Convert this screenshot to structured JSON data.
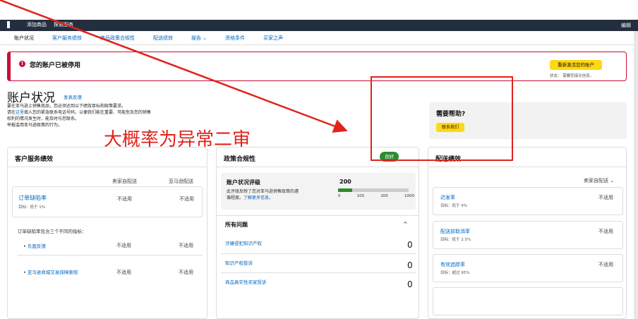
{
  "topbar": {
    "links": [
      "添加商品",
      "探索服务"
    ],
    "edit": "编辑"
  },
  "tabs": [
    "账户状况",
    "客户服务绩效",
    "商品政策合规性",
    "配送绩效",
    "报告 ⌄",
    "资格条件",
    "买家之声"
  ],
  "alert": {
    "title": "您的账户已被停用",
    "button": "重新激活您的账户",
    "status": "状态：  需要您接交信息。"
  },
  "page": {
    "title": "账户状况",
    "feedback": "发表反馈",
    "intro_line1": "要在亚马逊上销售商品，您必须达到以下绩效目标和政策要求。",
    "intro_line2_link": "这里",
    "intro_line2_pre": "请在",
    "intro_line2_post": "填入您的紧急联系电话号码，以便我们能在重要、可能危及您的销售",
    "intro_line3": "权利的情况发生时，能及时与您联系。",
    "intro_line4": "举报滥用亚马逊政策的行为。",
    "annotation": "大概率为异常二审"
  },
  "help": {
    "title": "需要帮助?",
    "button": "联系我们"
  },
  "customer_service": {
    "title": "客户服务绩效",
    "col1": "卖家自配送",
    "col2": "亚马逊配送",
    "metric_name": "订单缺陷率",
    "metric_target": "目标：低于 1%",
    "metric_v1": "不适用",
    "metric_v2": "不适用",
    "sub_caption": "订单缺陷率包含三个不同的指标：",
    "items": [
      {
        "label": "负面反馈",
        "v1": "不适用",
        "v2": "不适用"
      },
      {
        "label": "亚马逊商城交易保障索赔",
        "v1": "不适用",
        "v2": "不适用"
      }
    ]
  },
  "policy": {
    "title": "政策合规性",
    "badge": "良好",
    "rating_title": "账户状况评级",
    "rating_value": "200",
    "rating_desc1": "此评级反映了您对亚马逊销售政策的遵",
    "rating_desc2": "循程度。",
    "rating_link": "了解更多信息。",
    "scale": [
      "0",
      "100",
      "200",
      "1000"
    ],
    "rating_fraction": 0.2,
    "issues_title": "所有问题",
    "collapse": "^",
    "issues": [
      {
        "label": "涉嫌侵犯知识产权",
        "count": "0"
      },
      {
        "label": "知识产权投诉",
        "count": "0"
      },
      {
        "label": "商品真实性买家投诉",
        "count": "0"
      }
    ]
  },
  "shipping": {
    "title": "配送绩效",
    "selector": "卖家自配送 ⌄",
    "metrics": [
      {
        "name": "迟发率",
        "target": "目标：低于 4%",
        "value": "不适用"
      },
      {
        "name": "配送前取消率",
        "target": "目标：低于 2.5%",
        "value": "不适用"
      },
      {
        "name": "有效追踪率",
        "target": "目标：超过 95%",
        "value": "不适用"
      }
    ]
  },
  "colors": {
    "alert": "#cc0c39",
    "accent": "#ffd814",
    "good": "#2e8b2e",
    "annotation": "#e0231b"
  }
}
